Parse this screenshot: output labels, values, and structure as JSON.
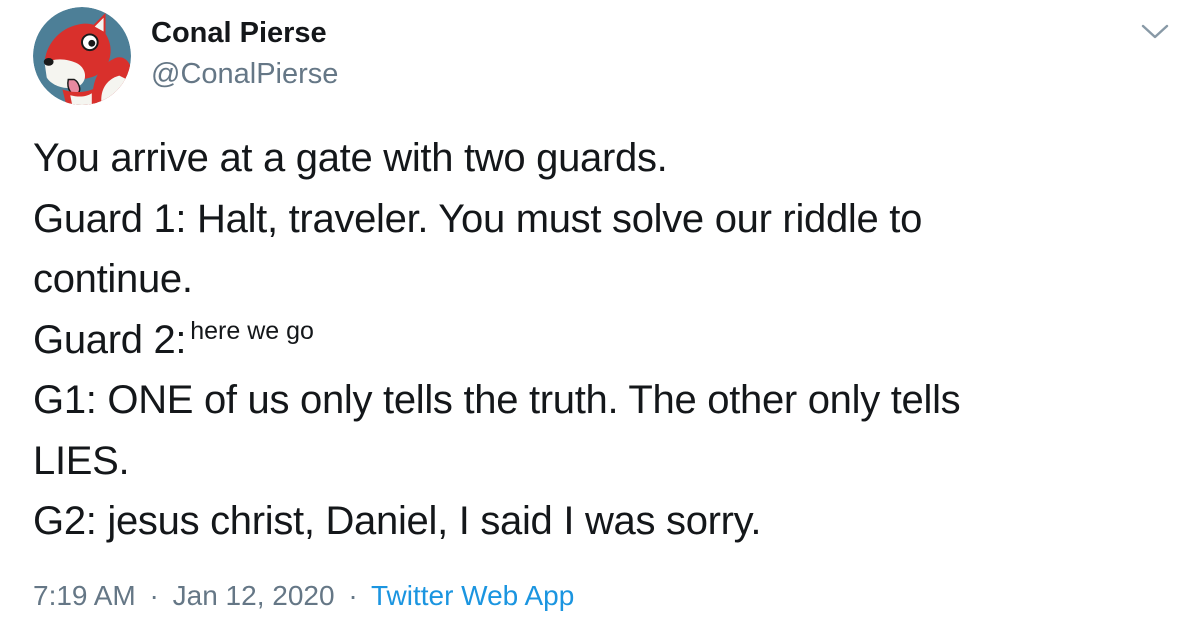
{
  "author": {
    "display_name": "Conal Pierse",
    "handle": "@ConalPierse",
    "avatar_icon": "cartoon-squirrel-avatar"
  },
  "menu": {
    "icon": "chevron-down-icon"
  },
  "tweet": {
    "lines": [
      "You arrive at a gate with two guards.",
      "Guard 1: Halt, traveler. You must solve our riddle to",
      "continue.",
      "Guard 2:",
      "G1: ONE of us only tells the truth. The other only tells",
      "LIES.",
      "G2: jesus christ, Daniel, I said I was sorry."
    ],
    "aside": "here we go"
  },
  "meta": {
    "time": "7:19 AM",
    "separator": "·",
    "date": "Jan 12, 2020",
    "source": "Twitter Web App"
  },
  "colors": {
    "text": "#14171a",
    "secondary": "#657786",
    "link": "#1b95e0",
    "avatar_bg": "#4d7f97",
    "avatar_red": "#d9302c"
  }
}
